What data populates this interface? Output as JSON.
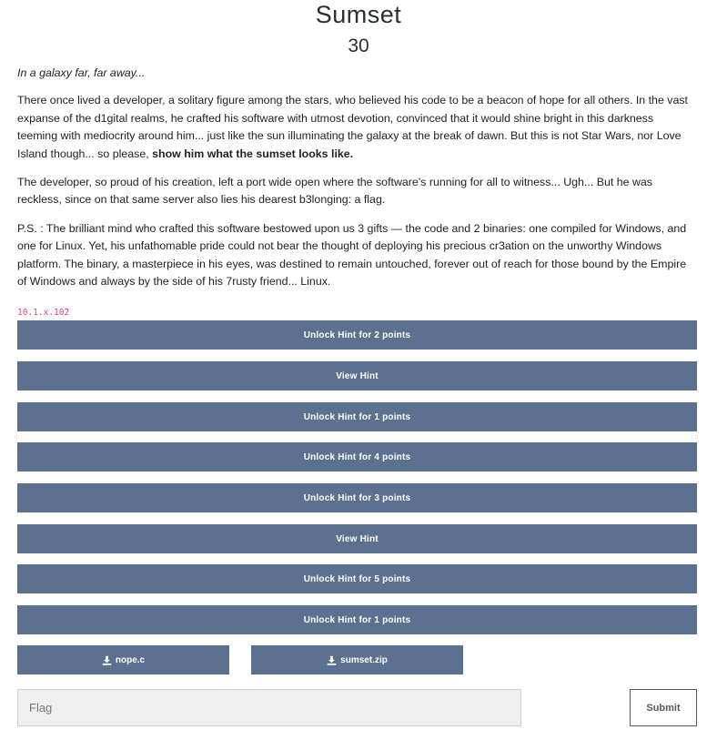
{
  "challenge": {
    "title": "Sumset",
    "points": "30"
  },
  "description": {
    "intro": "In a galaxy far, far away...",
    "p1_text": "There once lived a developer, a solitary figure among the stars, who believed his code to be a beacon of hope for all others. In the vast expanse of the d1gital realms, he crafted his software with utmost devotion, convinced that it would shine bright in this darkness teeming with mediocrity around him... just like the sun illuminating the galaxy at the break of dawn. But this is not Star Wars, nor Love Island though... so please, ",
    "p1_bold": "show him what the sumset looks like.",
    "p2": "The developer, so proud of his creation, left a port wide open where the software's running for all to witness... Ugh... But he was reckless, since on that same server also lies his dearest b3longing: a flag.",
    "p3": "P.S. : The brilliant mind who crafted this software bestowed upon us 3 gifts — the code and 2 binaries: one compiled for Windows, and one for Linux. Yet, his unfathomable pride could not bear the thought of deploying his precious cr3ation on the unworthy Windows platform. The binary, a masterpiece in his eyes, was destined to remain untouched, forever out of reach for those bound by the Empire of Windows and always by the side of his 7rusty friend... Linux."
  },
  "connection": "10.1.x.102",
  "hints": [
    {
      "label": "Unlock Hint for 2 points"
    },
    {
      "label": "View Hint"
    },
    {
      "label": "Unlock Hint for 1 points"
    },
    {
      "label": "Unlock Hint for 4 points"
    },
    {
      "label": "Unlock Hint for 3 points"
    },
    {
      "label": "View Hint"
    },
    {
      "label": "Unlock Hint for 5 points"
    },
    {
      "label": "Unlock Hint for 1 points"
    }
  ],
  "files": [
    {
      "name": "nope.c",
      "icon": "download-icon"
    },
    {
      "name": "sumset.zip",
      "icon": "download-icon"
    }
  ],
  "submission": {
    "placeholder": "Flag",
    "value": "",
    "submit_label": "Submit"
  },
  "colors": {
    "button_bg": "#5c718f",
    "connection_text": "#e83e8c"
  }
}
